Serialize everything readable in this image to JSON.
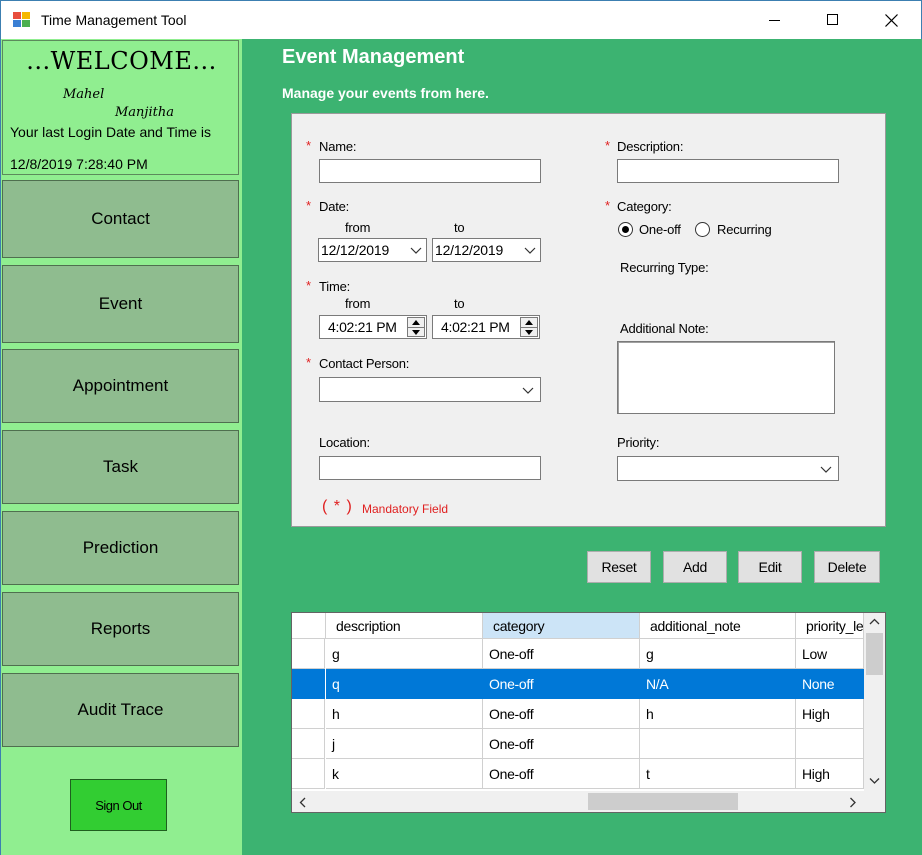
{
  "window": {
    "title": "Time Management Tool",
    "minimize_icon": "minimize-icon",
    "maximize_icon": "maximize-icon",
    "close_icon": "close-icon"
  },
  "sidebar": {
    "welcome": "...WELCOME...",
    "user_first": "Mahel",
    "user_last": "Manjitha",
    "last_login_label": "Your last Login Date and Time is",
    "last_login_value": "12/8/2019 7:28:40 PM",
    "nav": [
      "Contact",
      "Event",
      "Appointment",
      "Task",
      "Prediction",
      "Reports",
      "Audit Trace"
    ],
    "sign_out": "Sign Out"
  },
  "main": {
    "title": "Event Management",
    "subtitle": "Manage your events from here."
  },
  "form": {
    "required_mark": "*",
    "name_label": "Name:",
    "name_value": "",
    "description_label": "Description:",
    "description_value": "",
    "date_label": "Date:",
    "from_label": "from",
    "to_label": "to",
    "date_from": "12/12/2019",
    "date_to": "12/12/2019",
    "category_label": "Category:",
    "category_options": [
      "One-off",
      "Recurring"
    ],
    "category_selected": "One-off",
    "time_label": "Time:",
    "time_from": "4:02:21 PM",
    "time_to": "4:02:21 PM",
    "recurring_type_label": "Recurring Type:",
    "additional_note_label": "Additional Note:",
    "additional_note_value": "",
    "contact_person_label": "Contact Person:",
    "contact_person_value": "",
    "location_label": "Location:",
    "location_value": "",
    "priority_label": "Priority:",
    "priority_value": "",
    "mandatory_mark": "( * )",
    "mandatory_text": "Mandatory Field"
  },
  "buttons": {
    "reset": "Reset",
    "add": "Add",
    "edit": "Edit",
    "delete": "Delete"
  },
  "grid": {
    "columns": [
      "description",
      "category",
      "additional_note",
      "priority_level"
    ],
    "selected_column": "category",
    "selected_row": 1,
    "rows": [
      [
        "g",
        "One-off",
        "g",
        "Low"
      ],
      [
        "q",
        "One-off",
        "N/A",
        "None"
      ],
      [
        "h",
        "One-off",
        "h",
        "High"
      ],
      [
        "j",
        "One-off",
        "",
        ""
      ],
      [
        "k",
        "One-off",
        "t",
        "High"
      ]
    ]
  },
  "colors": {
    "sidebar_bg": "#90ee90",
    "nav_button_bg": "#8fbc8f",
    "main_bg": "#3cb371",
    "sign_out_bg": "#32cd32",
    "selection": "#0078d7",
    "mandatory": "#e02020"
  }
}
